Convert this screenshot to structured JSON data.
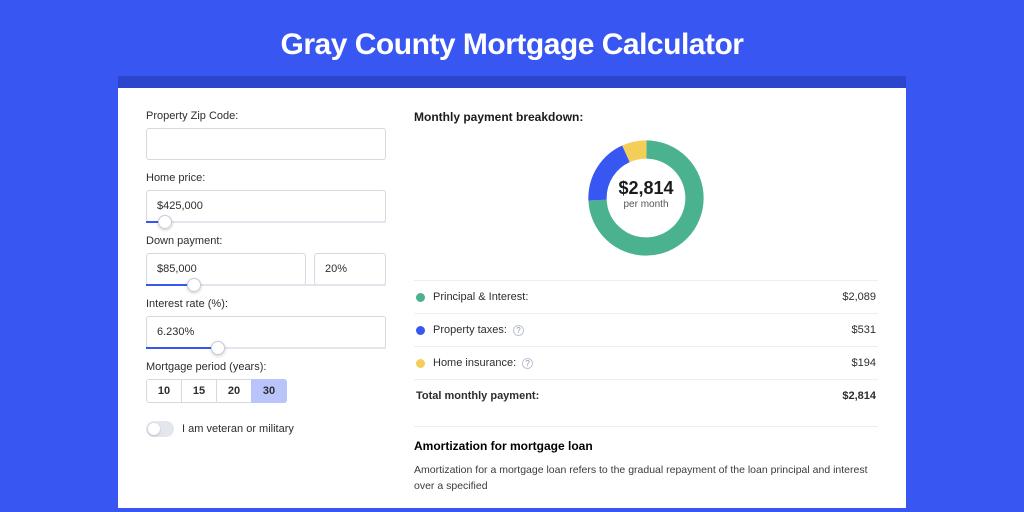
{
  "page": {
    "title": "Gray County Mortgage Calculator"
  },
  "form": {
    "zip_label": "Property Zip Code:",
    "zip_value": "",
    "home_price_label": "Home price:",
    "home_price_value": "$425,000",
    "home_price_slider_pct": 8,
    "down_payment_label": "Down payment:",
    "down_payment_value": "$85,000",
    "down_payment_pct_value": "20%",
    "down_payment_slider_pct": 20,
    "interest_label": "Interest rate (%):",
    "interest_value": "6.230%",
    "interest_slider_pct": 30,
    "period_label": "Mortgage period (years):",
    "period_options": [
      "10",
      "15",
      "20",
      "30"
    ],
    "period_selected": "30",
    "veteran_label": "I am veteran or military",
    "veteran_checked": false
  },
  "breakdown": {
    "title": "Monthly payment breakdown:",
    "center_amount": "$2,814",
    "center_sub": "per month",
    "items": [
      {
        "name": "Principal & Interest:",
        "value": "$2,089",
        "color": "#4bb28f",
        "help": false
      },
      {
        "name": "Property taxes:",
        "value": "$531",
        "color": "#3857f2",
        "help": true
      },
      {
        "name": "Home insurance:",
        "value": "$194",
        "color": "#f3cf57",
        "help": true
      }
    ],
    "total_label": "Total monthly payment:",
    "total_value": "$2,814"
  },
  "amortization": {
    "title": "Amortization for mortgage loan",
    "text": "Amortization for a mortgage loan refers to the gradual repayment of the loan principal and interest over a specified"
  },
  "chart_data": {
    "type": "pie",
    "title": "Monthly payment breakdown",
    "series": [
      {
        "name": "Principal & Interest",
        "value": 2089,
        "color": "#4bb28f"
      },
      {
        "name": "Property taxes",
        "value": 531,
        "color": "#3857f2"
      },
      {
        "name": "Home insurance",
        "value": 194,
        "color": "#f3cf57"
      }
    ],
    "total": 2814,
    "center_label": "$2,814 per month",
    "donut": true
  }
}
